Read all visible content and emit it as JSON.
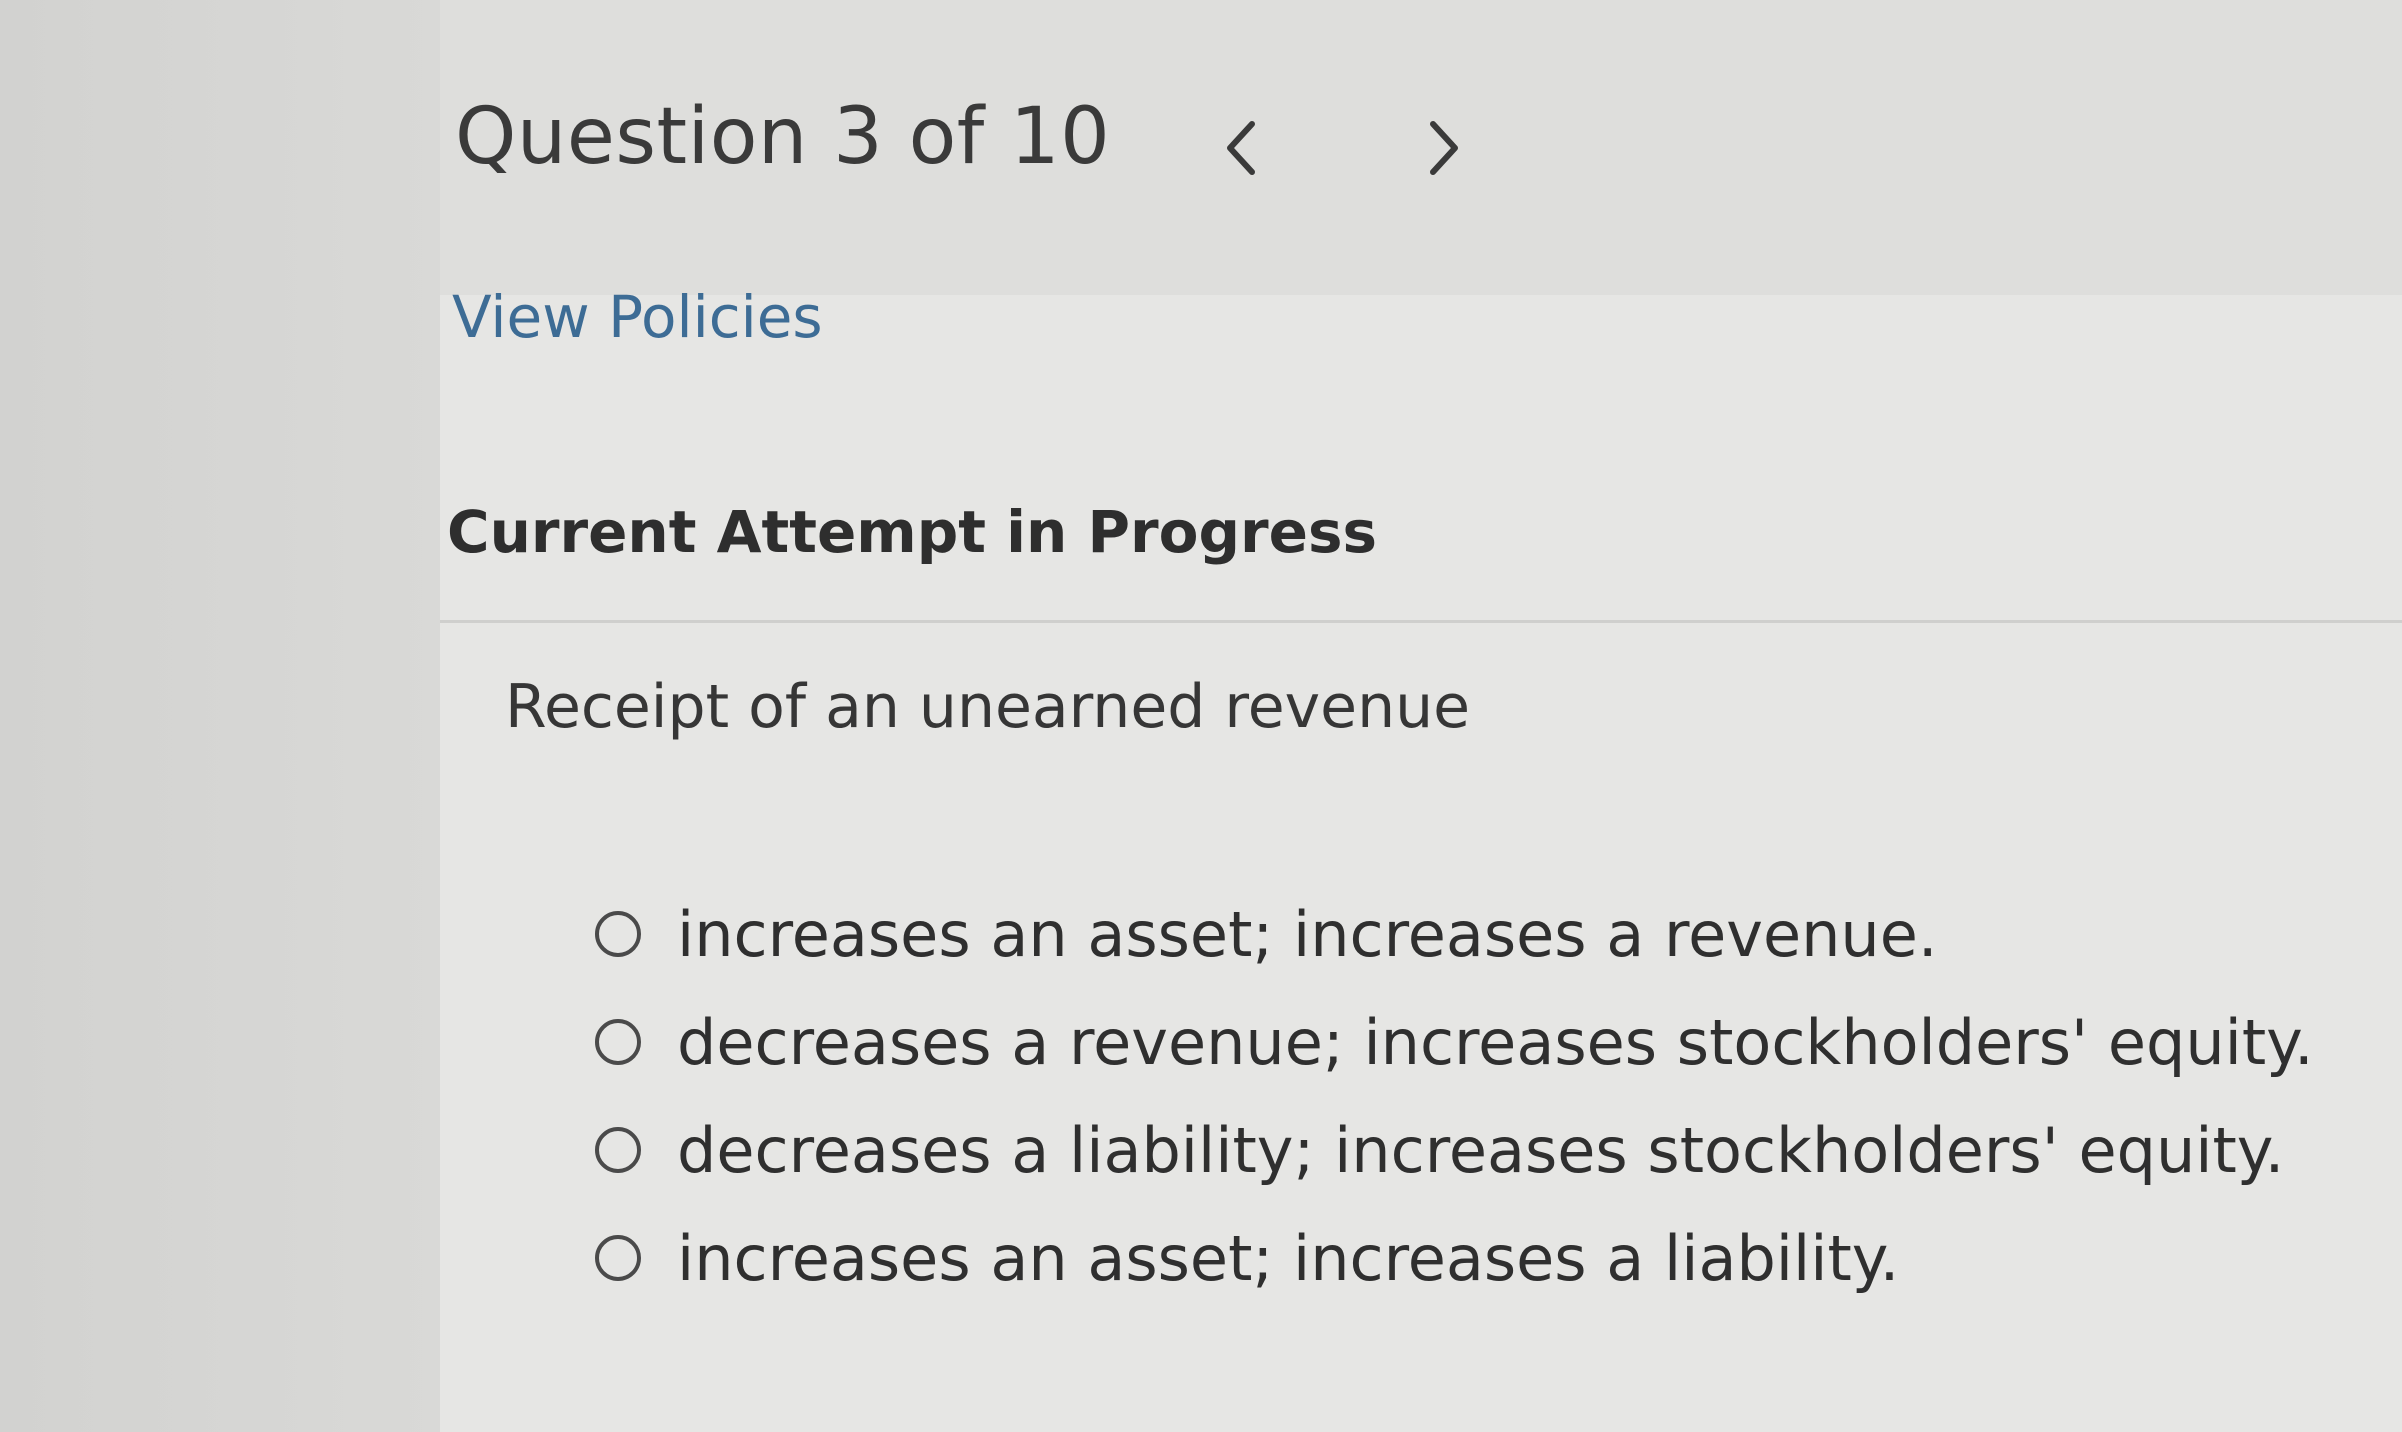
{
  "header": {
    "question_counter": "Question 3 of 10",
    "prev_icon": "chevron-left-icon",
    "next_icon": "chevron-right-icon"
  },
  "links": {
    "view_policies": "View Policies"
  },
  "attempt": {
    "title": "Current Attempt in Progress"
  },
  "question": {
    "prompt": "Receipt of an unearned revenue",
    "options": [
      {
        "label": "increases an asset; increases a revenue.",
        "selected": false
      },
      {
        "label": "decreases a revenue; increases stockholders' equity.",
        "selected": false
      },
      {
        "label": "decreases a liability; increases stockholders' equity.",
        "selected": false
      },
      {
        "label": "increases an asset; increases a liability.",
        "selected": false
      }
    ]
  },
  "colors": {
    "link": "#3d6c95",
    "text": "#363636",
    "background": "#e4e4e2"
  }
}
